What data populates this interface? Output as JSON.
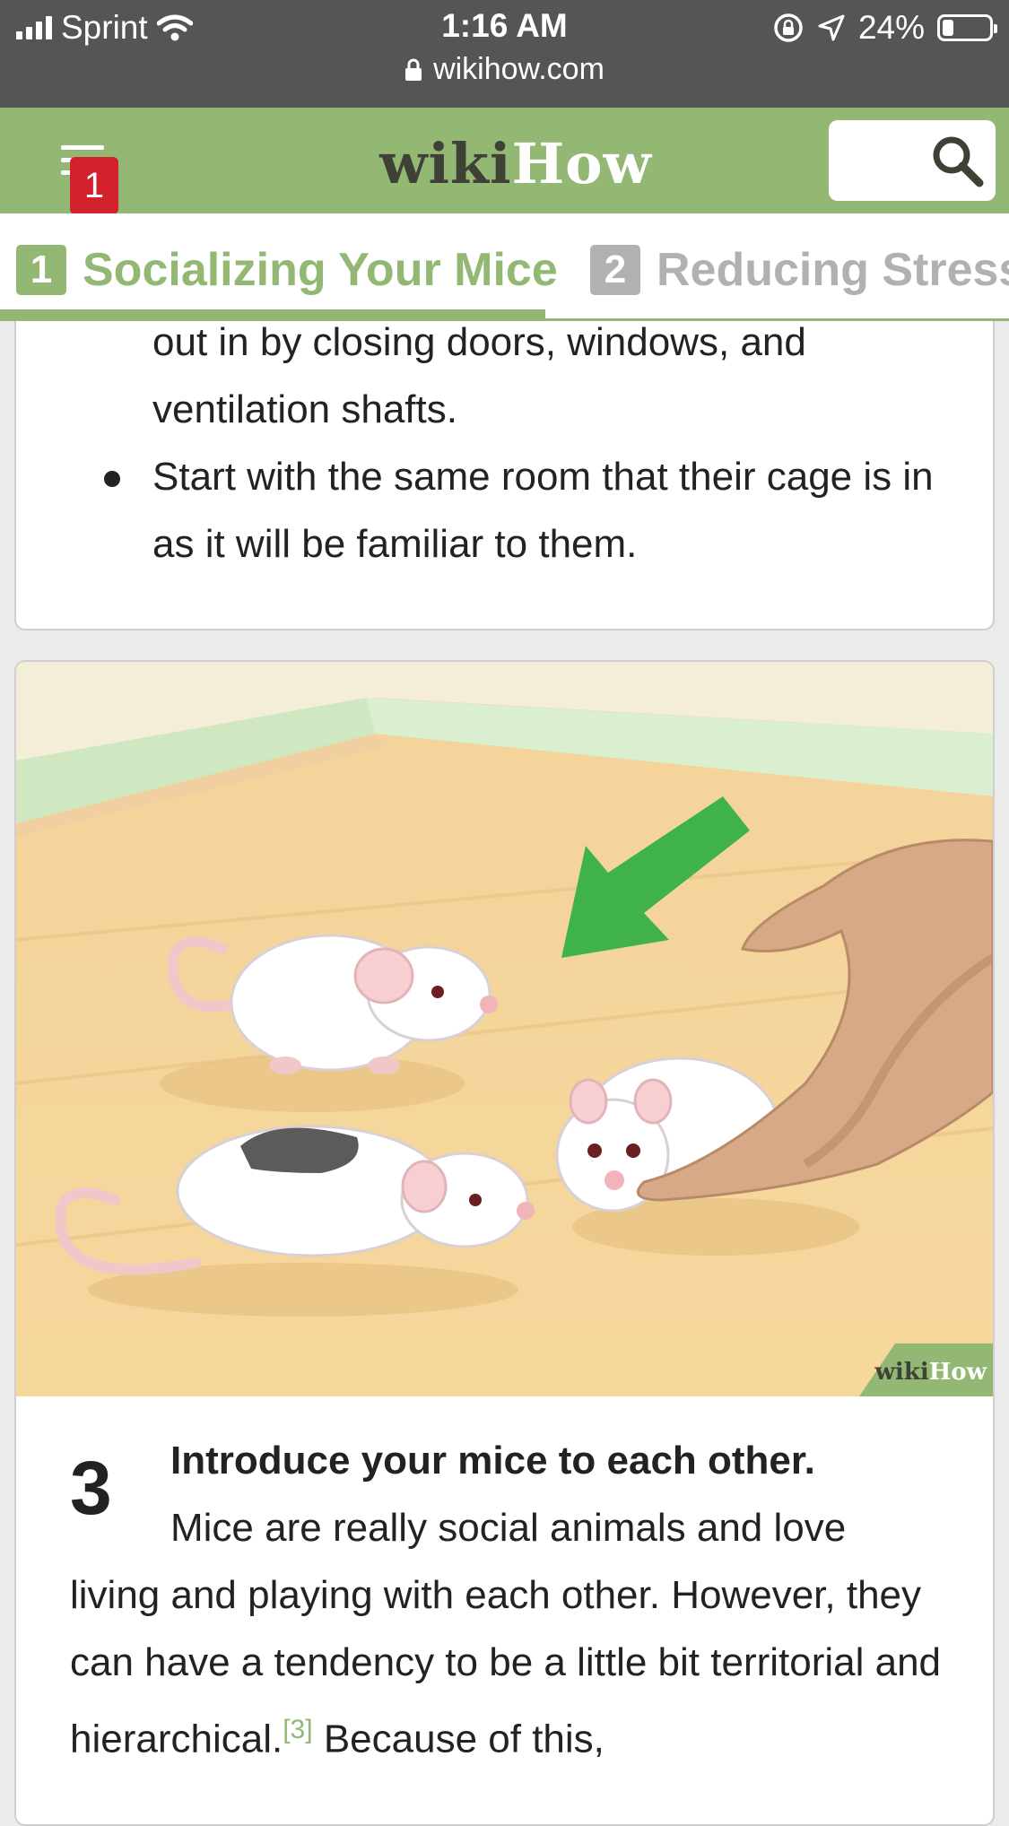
{
  "status_bar": {
    "carrier": "Sprint",
    "time": "1:16 AM",
    "battery": "24%",
    "battery_level": 0.24,
    "url": "wikihow.com",
    "icons": [
      "signal-icon",
      "wifi-icon",
      "rotation-lock-icon",
      "location-icon",
      "battery-icon",
      "lock-icon"
    ]
  },
  "header": {
    "logo_wiki": "wiki",
    "logo_how": "How",
    "notification_count": "1",
    "icons": [
      "menu-icon",
      "search-icon"
    ],
    "colors": {
      "brand_green": "#93b874",
      "badge_red": "#d3222e",
      "logo_dark": "#3f4137"
    }
  },
  "tabs": [
    {
      "number": "1",
      "label": "Socializing Your Mice",
      "active": true
    },
    {
      "number": "2",
      "label": "Reducing Stress",
      "active": false
    }
  ],
  "content": {
    "bullets": [
      "out in by closing doors, windows, and ventilation shafts.",
      "Start with the same room that their cage is in as it will be familiar to them."
    ],
    "step": {
      "number": "3",
      "title": "Introduce your mice to each other.",
      "body_first_line": "Mice are really social animals and love",
      "body_rest": "living and playing with each other. However, they can have a tendency to be a little bit territorial and hierarchical.",
      "ref": "[3]",
      "body_after": "Because of this,",
      "image_watermark_wiki": "wiki",
      "image_watermark_how": "How"
    }
  }
}
